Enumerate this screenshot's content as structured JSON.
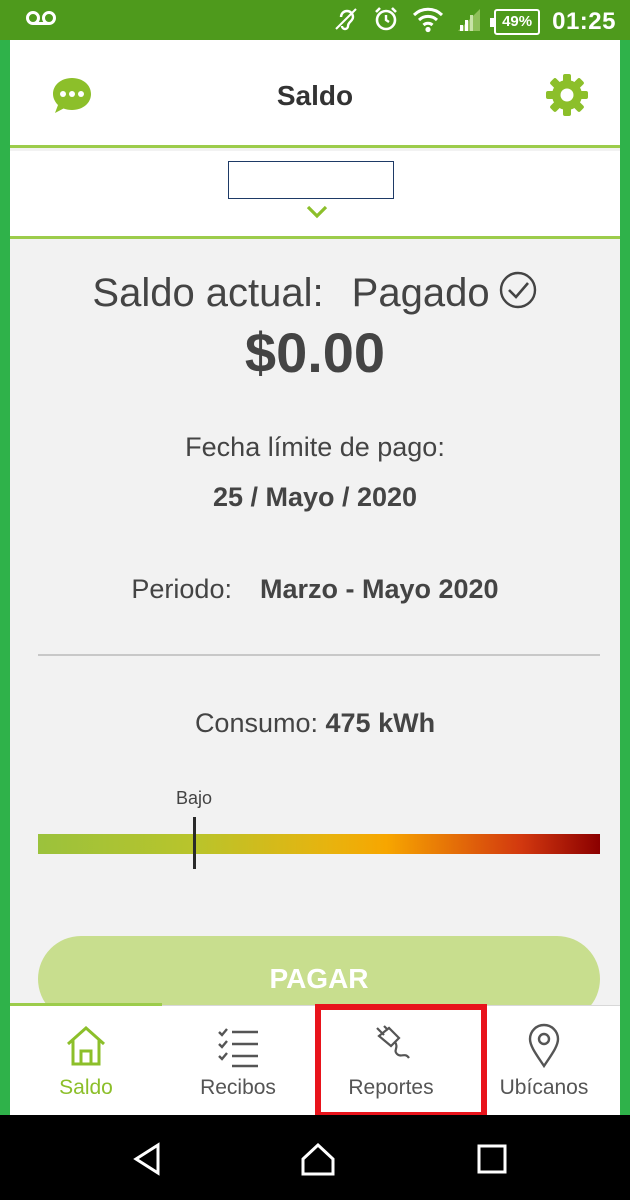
{
  "status_bar": {
    "battery": "49%",
    "time": "01:25",
    "icons": [
      "voicemail-icon",
      "hearing-aid-icon",
      "alarm-icon",
      "wifi-icon",
      "signal-icon",
      "battery-icon"
    ]
  },
  "header": {
    "title": "Saldo",
    "left_icon": "chat-icon",
    "right_icon": "gear-icon"
  },
  "account_selector": {
    "value": "",
    "icon": "chevron-down-icon"
  },
  "balance": {
    "label": "Saldo actual:",
    "status": "Pagado",
    "status_icon": "check-circle-icon",
    "amount": "$0.00"
  },
  "due": {
    "label": "Fecha límite de pago:",
    "date": "25 / Mayo / 2020"
  },
  "period": {
    "label": "Periodo:",
    "value": "Marzo - Mayo 2020"
  },
  "consumption": {
    "label": "Consumo:",
    "value": "475 kWh",
    "level_label": "Bajo",
    "level_fraction": 0.28
  },
  "pay_button": {
    "label": "PAGAR"
  },
  "bottom_nav": {
    "items": [
      {
        "label": "Saldo",
        "icon": "home-icon",
        "active": true
      },
      {
        "label": "Recibos",
        "icon": "checklist-icon",
        "active": false
      },
      {
        "label": "Reportes",
        "icon": "plug-icon",
        "active": false
      },
      {
        "label": "Ubícanos",
        "icon": "location-pin-icon",
        "active": false
      }
    ]
  },
  "colors": {
    "brand_green": "#4e9a1c",
    "accent_green": "#8cbf2a",
    "highlight_red": "#e8131b"
  }
}
